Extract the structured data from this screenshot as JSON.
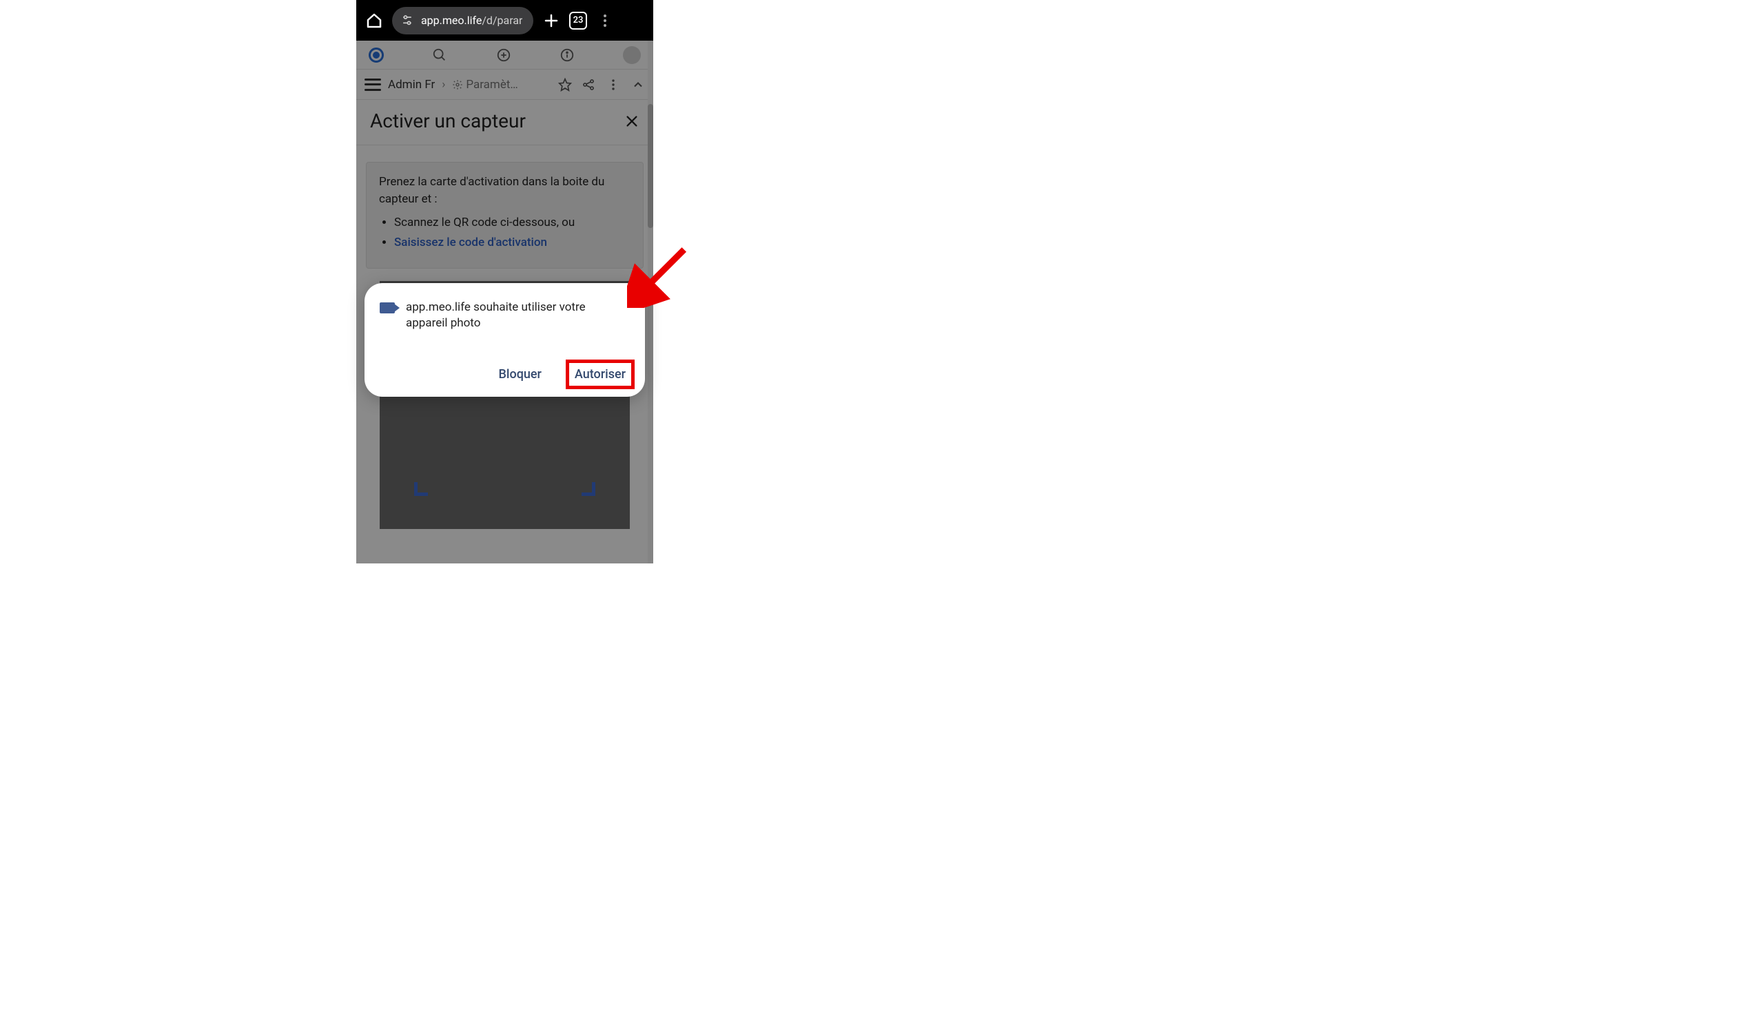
{
  "browser": {
    "url_domain": "app.meo.life",
    "url_path": "/d/parar",
    "tab_count": "23"
  },
  "app_header": {
    "icons": [
      "search-icon",
      "plus-circle-icon",
      "info-icon",
      "avatar"
    ]
  },
  "breadcrumb": {
    "root": "Admin Fr",
    "current": "Paramèt…"
  },
  "modal": {
    "title": "Activer un capteur",
    "intro": "Prenez la carte d'activation dans la boite du capteur et :",
    "items": [
      "Scannez le QR code ci-dessous, ou",
      "Saisissez le code d'activation"
    ]
  },
  "permission": {
    "message": "app.meo.life souhaite utiliser votre appareil photo",
    "block": "Bloquer",
    "allow": "Autoriser"
  },
  "annotation": {
    "arrow_color": "#e80000"
  }
}
